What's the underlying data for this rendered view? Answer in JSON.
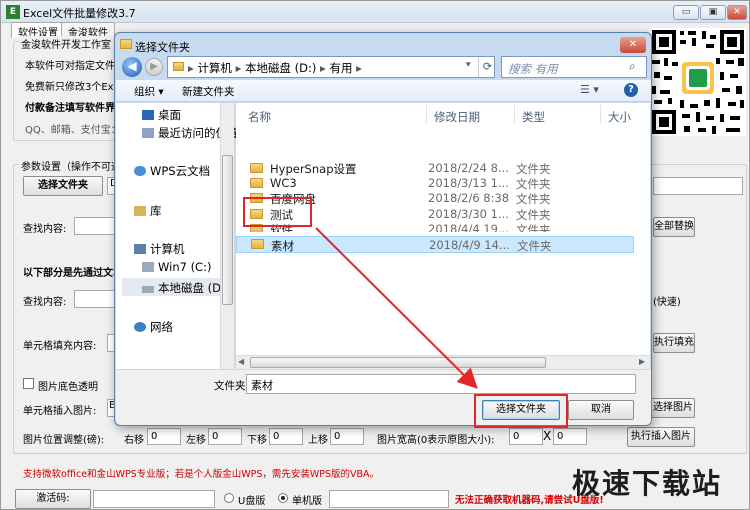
{
  "app": {
    "title": "Excel文件批量修改3.7",
    "icon_char": "E",
    "minimize": "▭",
    "maximize": "▣",
    "close": "✕",
    "tabs": [
      "软件设置",
      "金浚软件"
    ],
    "info_group_label": "金浚软件开发工作室  信息",
    "info_lines": [
      "本软件可对指定文件",
      "免费新只修改3个Excel",
      "付款备注填写软件界面",
      "QQ、邮箱、支付宝："
    ],
    "params_label": "参数设置（操作不可逆，请",
    "choose_folder_btn": "选择文件夹",
    "path_value": "D:",
    "find_label": "查找内容:",
    "replace_all_btn": "全部替换",
    "section_note": "以下部分是先通过文本",
    "find_label2": "查找内容:",
    "fast_note": "(快速)",
    "cell_fill_label": "单元格填充内容:",
    "exec_fill_btn": "执行填充",
    "pic_transparent": "图片底色透明",
    "cell_insert_pic_label": "单元格插入图片:",
    "insert_path": "E:",
    "choose_pic_btn": "选择图片",
    "pos_label": "图片位置调整(磅):",
    "right_label": "右移",
    "right_val": "0",
    "left_label": "左移",
    "left_val": "0",
    "down_label": "下移",
    "down_val": "0",
    "up_label": "上移",
    "up_val": "0",
    "size_label": "图片宽高(0表示原图大小):",
    "width_val": "0",
    "x_sep": "X",
    "height_val": "0",
    "exec_insert_btn": "执行插入图片",
    "support_note": "支持微软office和金山WPS专业版；若是个人版金山WPS，需先安装WPS版的VBA。",
    "activate_label": "激活码:",
    "radio_u": "U盘版",
    "radio_pc": "单机版",
    "error_msg": "无法正确获取机器码,请尝试U盘版!"
  },
  "dialog": {
    "title": "选择文件夹",
    "close": "✕",
    "address": [
      "计算机",
      "本地磁盘 (D:)",
      "有用"
    ],
    "search_placeholder": "搜索 有用",
    "toolbar": {
      "organize": "组织 ▾",
      "new_folder": "新建文件夹"
    },
    "nav": [
      "桌面",
      "最近访问的位置",
      "WPS云文档",
      "库",
      "计算机",
      "Win7 (C:)",
      "本地磁盘 (D:)",
      "网络"
    ],
    "columns": {
      "name": "名称",
      "date": "修改日期",
      "type": "类型",
      "size": "大小"
    },
    "files": [
      {
        "name": "HyperSnap设置",
        "date": "2018/2/24 8...",
        "type": "文件夹"
      },
      {
        "name": "WC3",
        "date": "2018/3/13 1...",
        "type": "文件夹"
      },
      {
        "name": "百度网盘",
        "date": "2018/2/6 8:38",
        "type": "文件夹"
      },
      {
        "name": "测试",
        "date": "2018/3/30 1...",
        "type": "文件夹"
      },
      {
        "name": "软件",
        "date": "2018/4/4 19...",
        "type": "文件夹"
      },
      {
        "name": "素材",
        "date": "2018/4/9 14...",
        "type": "文件夹"
      }
    ],
    "folder_label": "文件夹:",
    "folder_value": "素材",
    "select_btn": "选择文件夹",
    "cancel_btn": "取消"
  },
  "watermark": "极速下载站",
  "colors": {
    "red_highlight": "#e12727",
    "selected_row": "#cce8ff",
    "error_text": "#d00000"
  }
}
